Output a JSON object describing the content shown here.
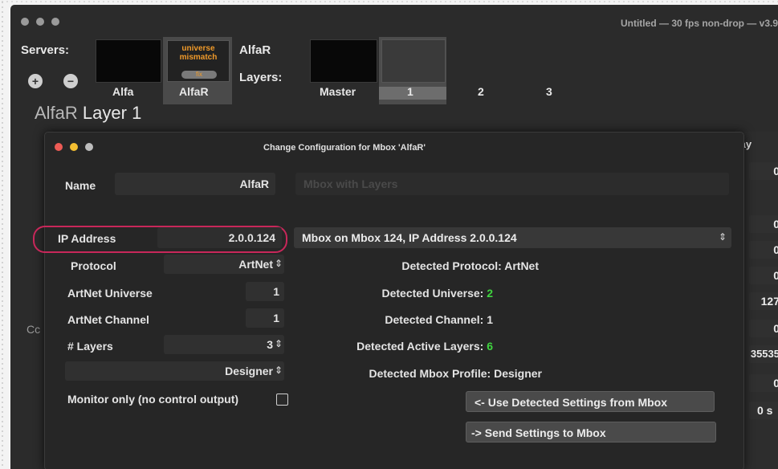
{
  "window": {
    "title": "Untitled  —  30 fps non-drop  —  v3.9"
  },
  "servers": {
    "label": "Servers:",
    "add_symbol": "+",
    "remove_symbol": "−",
    "items": [
      {
        "name": "Alfa"
      },
      {
        "name": "AlfaR",
        "warning_line1": "universe",
        "warning_line2": "mismatch",
        "fix_label": "fix"
      }
    ],
    "selected_name": "AlfaR"
  },
  "layers": {
    "label": "Layers:",
    "items": [
      {
        "name": "Master"
      },
      {
        "name": "1"
      },
      {
        "name": "2"
      },
      {
        "name": "3"
      }
    ]
  },
  "layer_header": {
    "server": "AlfaR",
    "layer": "Layer 1"
  },
  "dialog": {
    "title": "Change Configuration for Mbox 'AlfaR'",
    "name_label": "Name",
    "name_value": "AlfaR",
    "mode_placeholder": "Mbox with Layers",
    "ip_label": "IP Address",
    "ip_value": "2.0.0.124",
    "detected_device": "Mbox on Mbox 124, IP Address 2.0.0.124",
    "protocol_label": "Protocol",
    "protocol_value": "ArtNet",
    "universe_label": "ArtNet Universe",
    "universe_value": "1",
    "channel_label": "ArtNet Channel",
    "channel_value": "1",
    "layers_label": "# Layers",
    "layers_value": "3",
    "profile_value": "Designer",
    "monitor_label": "Monitor only (no control output)",
    "detected_protocol_label": "Detected Protocol:",
    "detected_protocol_value": "ArtNet",
    "detected_universe_label": "Detected Universe:",
    "detected_universe_value": "2",
    "detected_channel_label": "Detected Channel:",
    "detected_channel_value": "1",
    "detected_layers_label": "Detected Active Layers:",
    "detected_layers_value": "6",
    "detected_profile_label": "Detected Mbox Profile:",
    "detected_profile_value": "Designer",
    "use_detected_button": "<- Use Detected Settings from Mbox",
    "send_button": "-> Send Settings to Mbox"
  },
  "background_panel": {
    "left_cut_label": "Cc",
    "column_header": "lay",
    "values": [
      "0",
      "0",
      "0",
      "0",
      "127",
      "0",
      "35535",
      "0",
      "0 s"
    ]
  },
  "colors": {
    "highlight_ring": "#c8275a",
    "warning_orange": "#f09a2a",
    "detected_mismatch_green": "#3fd63f"
  }
}
